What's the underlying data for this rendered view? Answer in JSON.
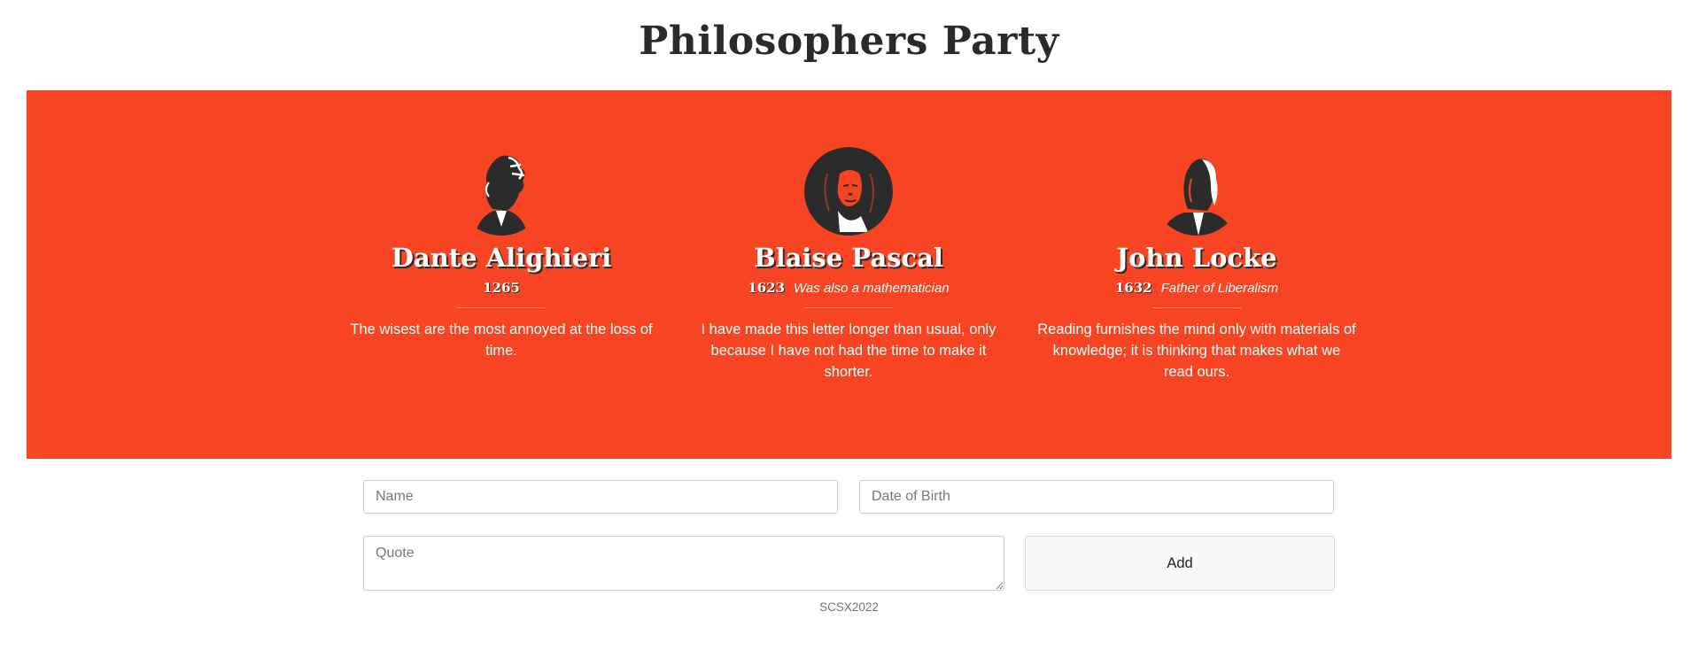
{
  "header": {
    "title": "Philosophers Party"
  },
  "colors": {
    "banner_background": "#f74422",
    "title_text": "#2a2a2a",
    "card_text": "#ffffff",
    "name_shadow": "#2b2b2b"
  },
  "philosophers": [
    {
      "name": "Dante Alighieri",
      "year": "1265",
      "note": "",
      "quote": "The wisest are the most annoyed at the loss of time.",
      "portrait_icon": "dante-portrait-icon"
    },
    {
      "name": "Blaise Pascal",
      "year": "1623",
      "note": "Was also a mathematician",
      "quote": "I have made this letter longer than usual, only because I have not had the time to make it shorter.",
      "portrait_icon": "pascal-portrait-icon"
    },
    {
      "name": "John Locke",
      "year": "1632",
      "note": "Father of Liberalism",
      "quote": "Reading furnishes the mind only with materials of knowledge; it is thinking that makes what we read ours.",
      "portrait_icon": "locke-portrait-icon"
    }
  ],
  "form": {
    "name_placeholder": "Name",
    "name_value": "",
    "dob_placeholder": "Date of Birth",
    "dob_value": "",
    "quote_placeholder": "Quote",
    "quote_value": "",
    "add_label": "Add"
  },
  "footer": {
    "text": "SCSX2022"
  }
}
